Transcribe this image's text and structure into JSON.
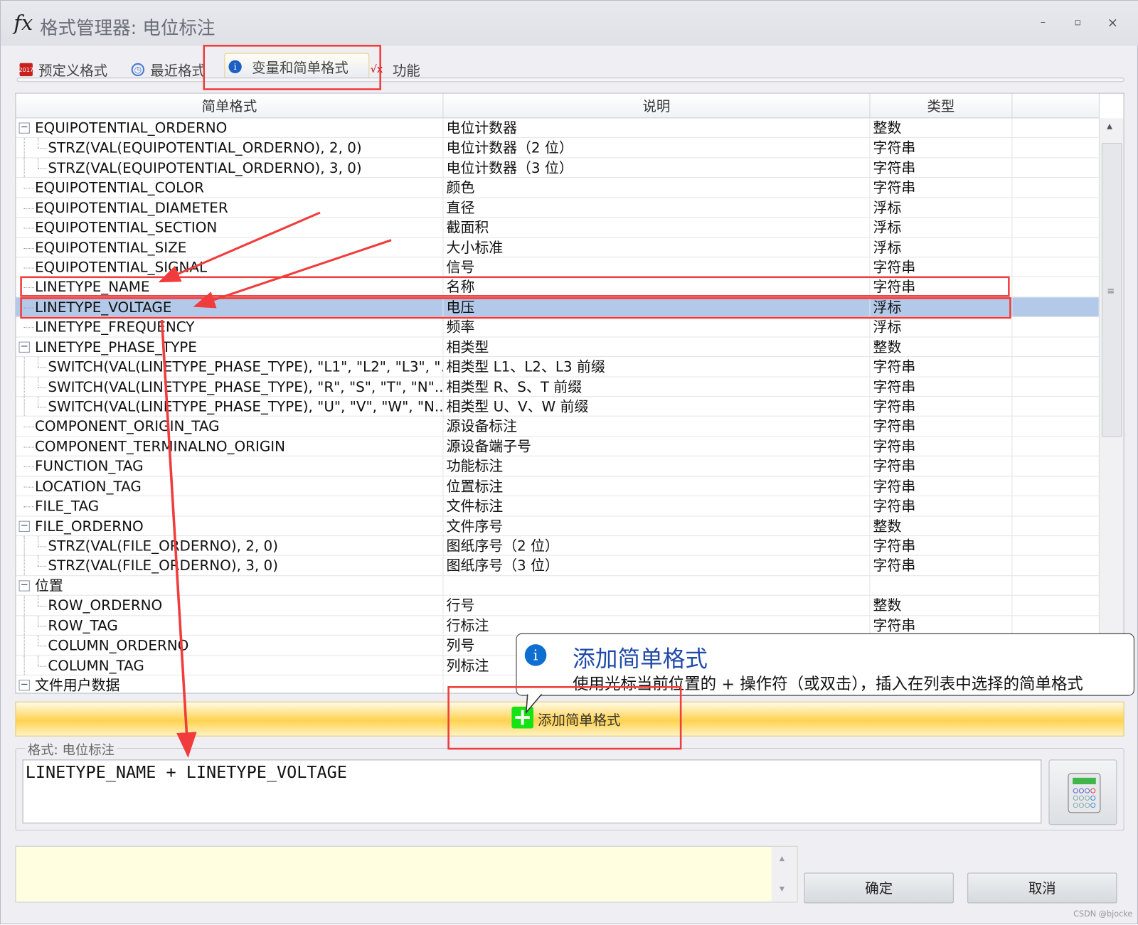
{
  "window": {
    "title": "格式管理器: 电位标注",
    "minimize": "–",
    "maximize": "▫",
    "close": "×"
  },
  "tabs": [
    {
      "label": "预定义格式",
      "icon": "eplan-2017-icon"
    },
    {
      "label": "最近格式",
      "icon": "clock-icon"
    },
    {
      "label": "变量和简单格式",
      "icon": "info-icon",
      "active": true
    },
    {
      "label": "功能",
      "icon": "sqrt-icon"
    }
  ],
  "grid": {
    "columns": [
      "简单格式",
      "说明",
      "类型"
    ],
    "rows": [
      {
        "name": "EQUIPOTENTIAL_ORDERNO",
        "desc": "电位计数器",
        "type": "整数",
        "level": 0,
        "expand": "−"
      },
      {
        "name": "STRZ(VAL(EQUIPOTENTIAL_ORDERNO), 2, 0)",
        "desc": "电位计数器（2 位）",
        "type": "字符串",
        "level": 1
      },
      {
        "name": "STRZ(VAL(EQUIPOTENTIAL_ORDERNO), 3, 0)",
        "desc": "电位计数器（3 位）",
        "type": "字符串",
        "level": 1
      },
      {
        "name": "EQUIPOTENTIAL_COLOR",
        "desc": "颜色",
        "type": "字符串",
        "level": 0
      },
      {
        "name": "EQUIPOTENTIAL_DIAMETER",
        "desc": "直径",
        "type": "浮标",
        "level": 0
      },
      {
        "name": "EQUIPOTENTIAL_SECTION",
        "desc": "截面积",
        "type": "浮标",
        "level": 0
      },
      {
        "name": "EQUIPOTENTIAL_SIZE",
        "desc": "大小标准",
        "type": "浮标",
        "level": 0
      },
      {
        "name": "EQUIPOTENTIAL_SIGNAL",
        "desc": "信号",
        "type": "字符串",
        "level": 0
      },
      {
        "name": "LINETYPE_NAME",
        "desc": "名称",
        "type": "字符串",
        "level": 0
      },
      {
        "name": "LINETYPE_VOLTAGE",
        "desc": "电压",
        "type": "浮标",
        "level": 0,
        "selected": true
      },
      {
        "name": "LINETYPE_FREQUENCY",
        "desc": "频率",
        "type": "浮标",
        "level": 0
      },
      {
        "name": "LINETYPE_PHASE_TYPE",
        "desc": "相类型",
        "type": "整数",
        "level": 0,
        "expand": "−"
      },
      {
        "name": "SWITCH(VAL(LINETYPE_PHASE_TYPE), \"L1\", \"L2\", \"L3\", \"...",
        "desc": "相类型 L1、L2、L3 前缀",
        "type": "字符串",
        "level": 1
      },
      {
        "name": "SWITCH(VAL(LINETYPE_PHASE_TYPE), \"R\", \"S\", \"T\", \"N\"...",
        "desc": "相类型 R、S、T 前缀",
        "type": "字符串",
        "level": 1
      },
      {
        "name": "SWITCH(VAL(LINETYPE_PHASE_TYPE), \"U\", \"V\", \"W\", \"N...",
        "desc": "相类型 U、V、W 前缀",
        "type": "字符串",
        "level": 1
      },
      {
        "name": "COMPONENT_ORIGIN_TAG",
        "desc": "源设备标注",
        "type": "字符串",
        "level": 0
      },
      {
        "name": "COMPONENT_TERMINALNO_ORIGIN",
        "desc": "源设备端子号",
        "type": "字符串",
        "level": 0
      },
      {
        "name": "FUNCTION_TAG",
        "desc": "功能标注",
        "type": "字符串",
        "level": 0
      },
      {
        "name": "LOCATION_TAG",
        "desc": "位置标注",
        "type": "字符串",
        "level": 0
      },
      {
        "name": "FILE_TAG",
        "desc": "文件标注",
        "type": "字符串",
        "level": 0
      },
      {
        "name": "FILE_ORDERNO",
        "desc": "文件序号",
        "type": "整数",
        "level": 0,
        "expand": "−"
      },
      {
        "name": "STRZ(VAL(FILE_ORDERNO), 2, 0)",
        "desc": "图纸序号（2 位）",
        "type": "字符串",
        "level": 1
      },
      {
        "name": "STRZ(VAL(FILE_ORDERNO), 3, 0)",
        "desc": "图纸序号（3 位）",
        "type": "字符串",
        "level": 1
      },
      {
        "name": "位置",
        "desc": "",
        "type": "",
        "level": 0,
        "expand": "−"
      },
      {
        "name": "ROW_ORDERNO",
        "desc": "行号",
        "type": "整数",
        "level": 1
      },
      {
        "name": "ROW_TAG",
        "desc": "行标注",
        "type": "字符串",
        "level": 1
      },
      {
        "name": "COLUMN_ORDERNO",
        "desc": "列号",
        "type": "",
        "level": 1
      },
      {
        "name": "COLUMN_TAG",
        "desc": "列标注",
        "type": "",
        "level": 1
      },
      {
        "name": "文件用户数据",
        "desc": "",
        "type": "",
        "level": 0,
        "expand": "−"
      }
    ]
  },
  "tooltip": {
    "title": "添加简单格式",
    "text": "使用光标当前位置的 + 操作符（或双击），插入在列表中选择的简单格式"
  },
  "add_button": {
    "label": "添加简单格式"
  },
  "format": {
    "legend": "格式: 电位标注",
    "value": "LINETYPE_NAME + LINETYPE_VOLTAGE"
  },
  "buttons": {
    "ok": "确定",
    "cancel": "取消"
  },
  "watermark": "CSDN @bjocke",
  "colors": {
    "selection": "#b3c9e9",
    "annotation": "#f03c3c",
    "add_bar": "#ffd350",
    "tooltip_title": "#1f4aa8"
  }
}
